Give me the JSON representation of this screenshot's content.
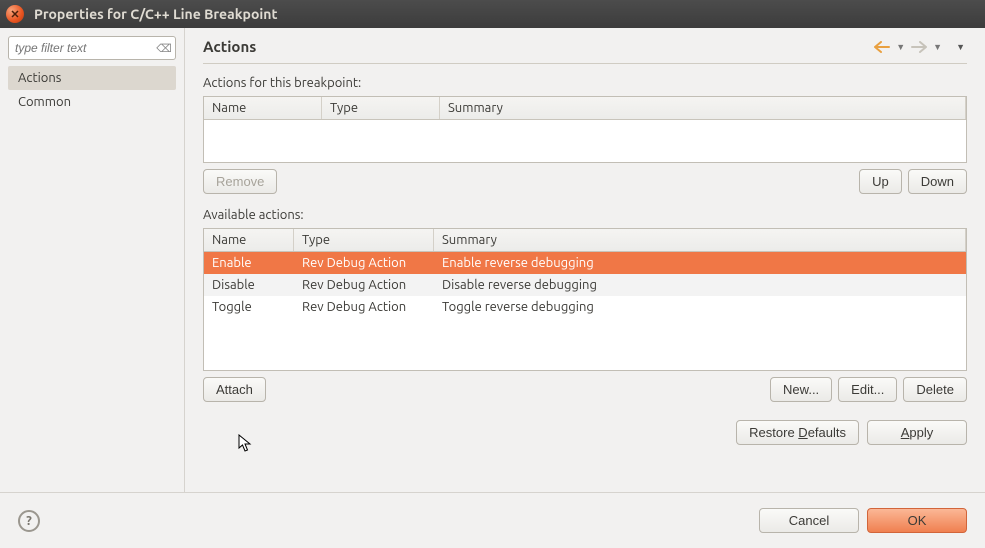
{
  "titlebar": {
    "title": "Properties for C/C++ Line Breakpoint"
  },
  "sidebar": {
    "filter_placeholder": "type filter text",
    "items": [
      {
        "label": "Actions",
        "selected": true
      },
      {
        "label": "Common",
        "selected": false
      }
    ]
  },
  "header": {
    "page_title": "Actions"
  },
  "sections": {
    "actions_label": "Actions for this breakpoint:",
    "available_label": "Available actions:"
  },
  "columns": {
    "name": "Name",
    "type": "Type",
    "summary": "Summary"
  },
  "actions_table": {
    "rows": []
  },
  "available_table": {
    "rows": [
      {
        "name": "Enable",
        "type": "Rev Debug Action",
        "summary": "Enable reverse debugging",
        "selected": true
      },
      {
        "name": "Disable",
        "type": "Rev Debug Action",
        "summary": "Disable reverse debugging",
        "selected": false
      },
      {
        "name": "Toggle",
        "type": "Rev Debug Action",
        "summary": "Toggle reverse debugging",
        "selected": false
      }
    ]
  },
  "buttons": {
    "remove": "Remove",
    "up": "Up",
    "down": "Down",
    "attach": "Attach",
    "new": "New...",
    "edit": "Edit...",
    "delete": "Delete",
    "restore_defaults": "Restore Defaults",
    "apply": "Apply",
    "cancel": "Cancel",
    "ok": "OK"
  }
}
